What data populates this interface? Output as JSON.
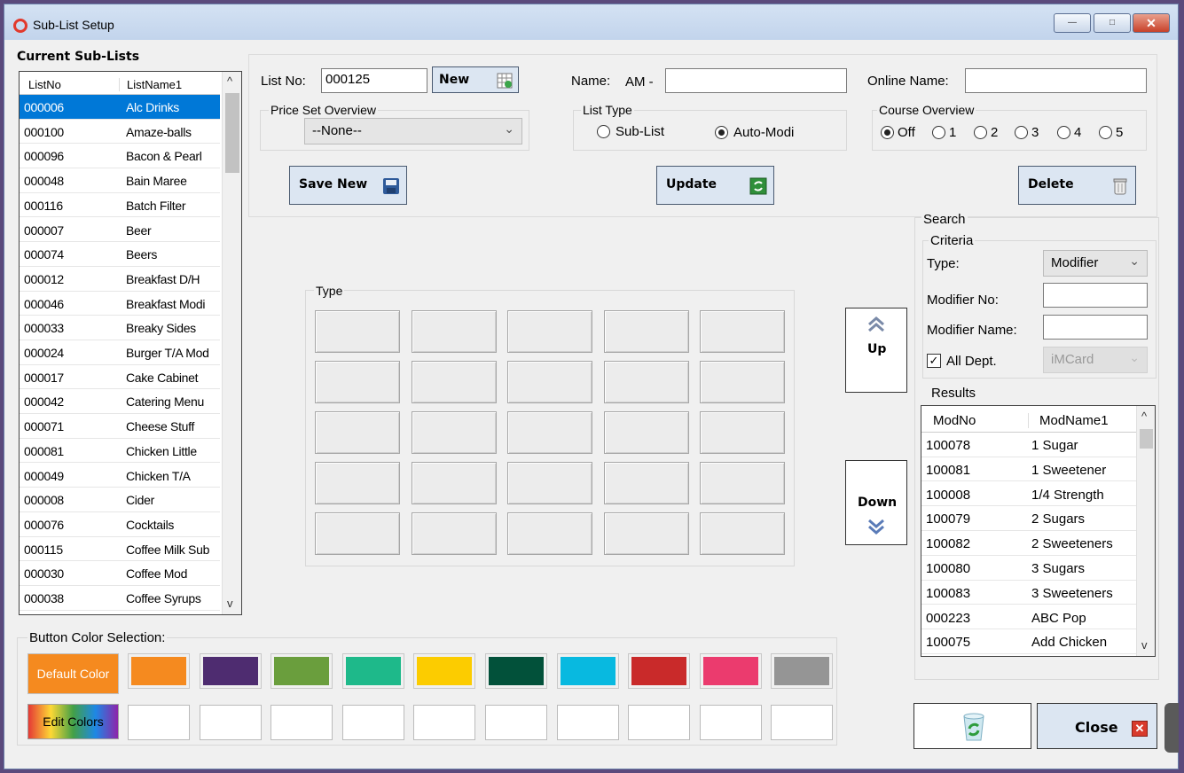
{
  "window": {
    "title": "Sub-List Setup",
    "minimize": "—",
    "maximize": "□",
    "close": "✕"
  },
  "sublists": {
    "heading": "Current Sub-Lists",
    "columns": [
      "ListNo",
      "ListName1"
    ],
    "rows": [
      [
        "000006",
        "Alc Drinks"
      ],
      [
        "000100",
        "Amaze-balls"
      ],
      [
        "000096",
        "Bacon & Pearl"
      ],
      [
        "000048",
        "Bain Maree"
      ],
      [
        "000116",
        "Batch Filter"
      ],
      [
        "000007",
        "Beer"
      ],
      [
        "000074",
        "Beers"
      ],
      [
        "000012",
        "Breakfast D/H"
      ],
      [
        "000046",
        "Breakfast Modi"
      ],
      [
        "000033",
        "Breaky Sides"
      ],
      [
        "000024",
        "Burger T/A Mod"
      ],
      [
        "000017",
        "Cake Cabinet"
      ],
      [
        "000042",
        "Catering Menu"
      ],
      [
        "000071",
        "Cheese Stuff"
      ],
      [
        "000081",
        "Chicken Little"
      ],
      [
        "000049",
        "Chicken T/A"
      ],
      [
        "000008",
        "Cider"
      ],
      [
        "000076",
        "Cocktails"
      ],
      [
        "000115",
        "Coffee Milk Sub"
      ],
      [
        "000030",
        "Coffee Mod"
      ],
      [
        "000038",
        "Coffee Syrups"
      ]
    ],
    "selected_index": 0
  },
  "form": {
    "listno_label": "List No:",
    "listno_value": "000125",
    "new_label": "New",
    "name_label": "Name:",
    "name_prefix": "AM -",
    "name_value": "",
    "online_label": "Online Name:",
    "online_value": "",
    "priceset_label": "Price Set Overview",
    "priceset_value": "--None--",
    "listtype_label": "List Type",
    "listtype_options": [
      "Sub-List",
      "Auto-Modi"
    ],
    "listtype_selected": "Auto-Modi",
    "course_label": "Course Overview",
    "course_options": [
      "Off",
      "1",
      "2",
      "3",
      "4",
      "5"
    ],
    "course_selected": "Off",
    "save_new_label": "Save New",
    "update_label": "Update",
    "delete_label": "Delete"
  },
  "type_grid": {
    "label": "Type",
    "rows": 5,
    "cols": 5
  },
  "move": {
    "up_label": "Up",
    "down_label": "Down"
  },
  "search": {
    "label": "Search",
    "criteria_label": "Criteria",
    "type_label": "Type:",
    "type_value": "Modifier",
    "modno_label": "Modifier No:",
    "modno_value": "",
    "modname_label": "Modifier Name:",
    "modname_value": "",
    "alldept_label": "All Dept.",
    "alldept_checked": true,
    "dept_value": "iMCard"
  },
  "results": {
    "label": "Results",
    "columns": [
      "ModNo",
      "ModName1"
    ],
    "rows": [
      [
        "100078",
        "1 Sugar"
      ],
      [
        "100081",
        "1 Sweetener"
      ],
      [
        "100008",
        "1/4 Strength"
      ],
      [
        "100079",
        "2 Sugars"
      ],
      [
        "100082",
        "2 Sweeteners"
      ],
      [
        "100080",
        "3 Sugars"
      ],
      [
        "100083",
        "3 Sweeteners"
      ],
      [
        "000223",
        "ABC Pop"
      ],
      [
        "100075",
        "Add Chicken"
      ]
    ]
  },
  "colors": {
    "label": "Button Color Selection:",
    "default_label": "Default Color",
    "edit_label": "Edit Colors",
    "swatches": [
      "#f58a1f",
      "#4e2c70",
      "#6a9e3d",
      "#1eb98a",
      "#fccc00",
      "#02513a",
      "#08b9e0",
      "#c92a2a",
      "#eb3b6e",
      "#959595"
    ],
    "accent": "#f58a1f"
  },
  "footer": {
    "close_label": "Close"
  }
}
